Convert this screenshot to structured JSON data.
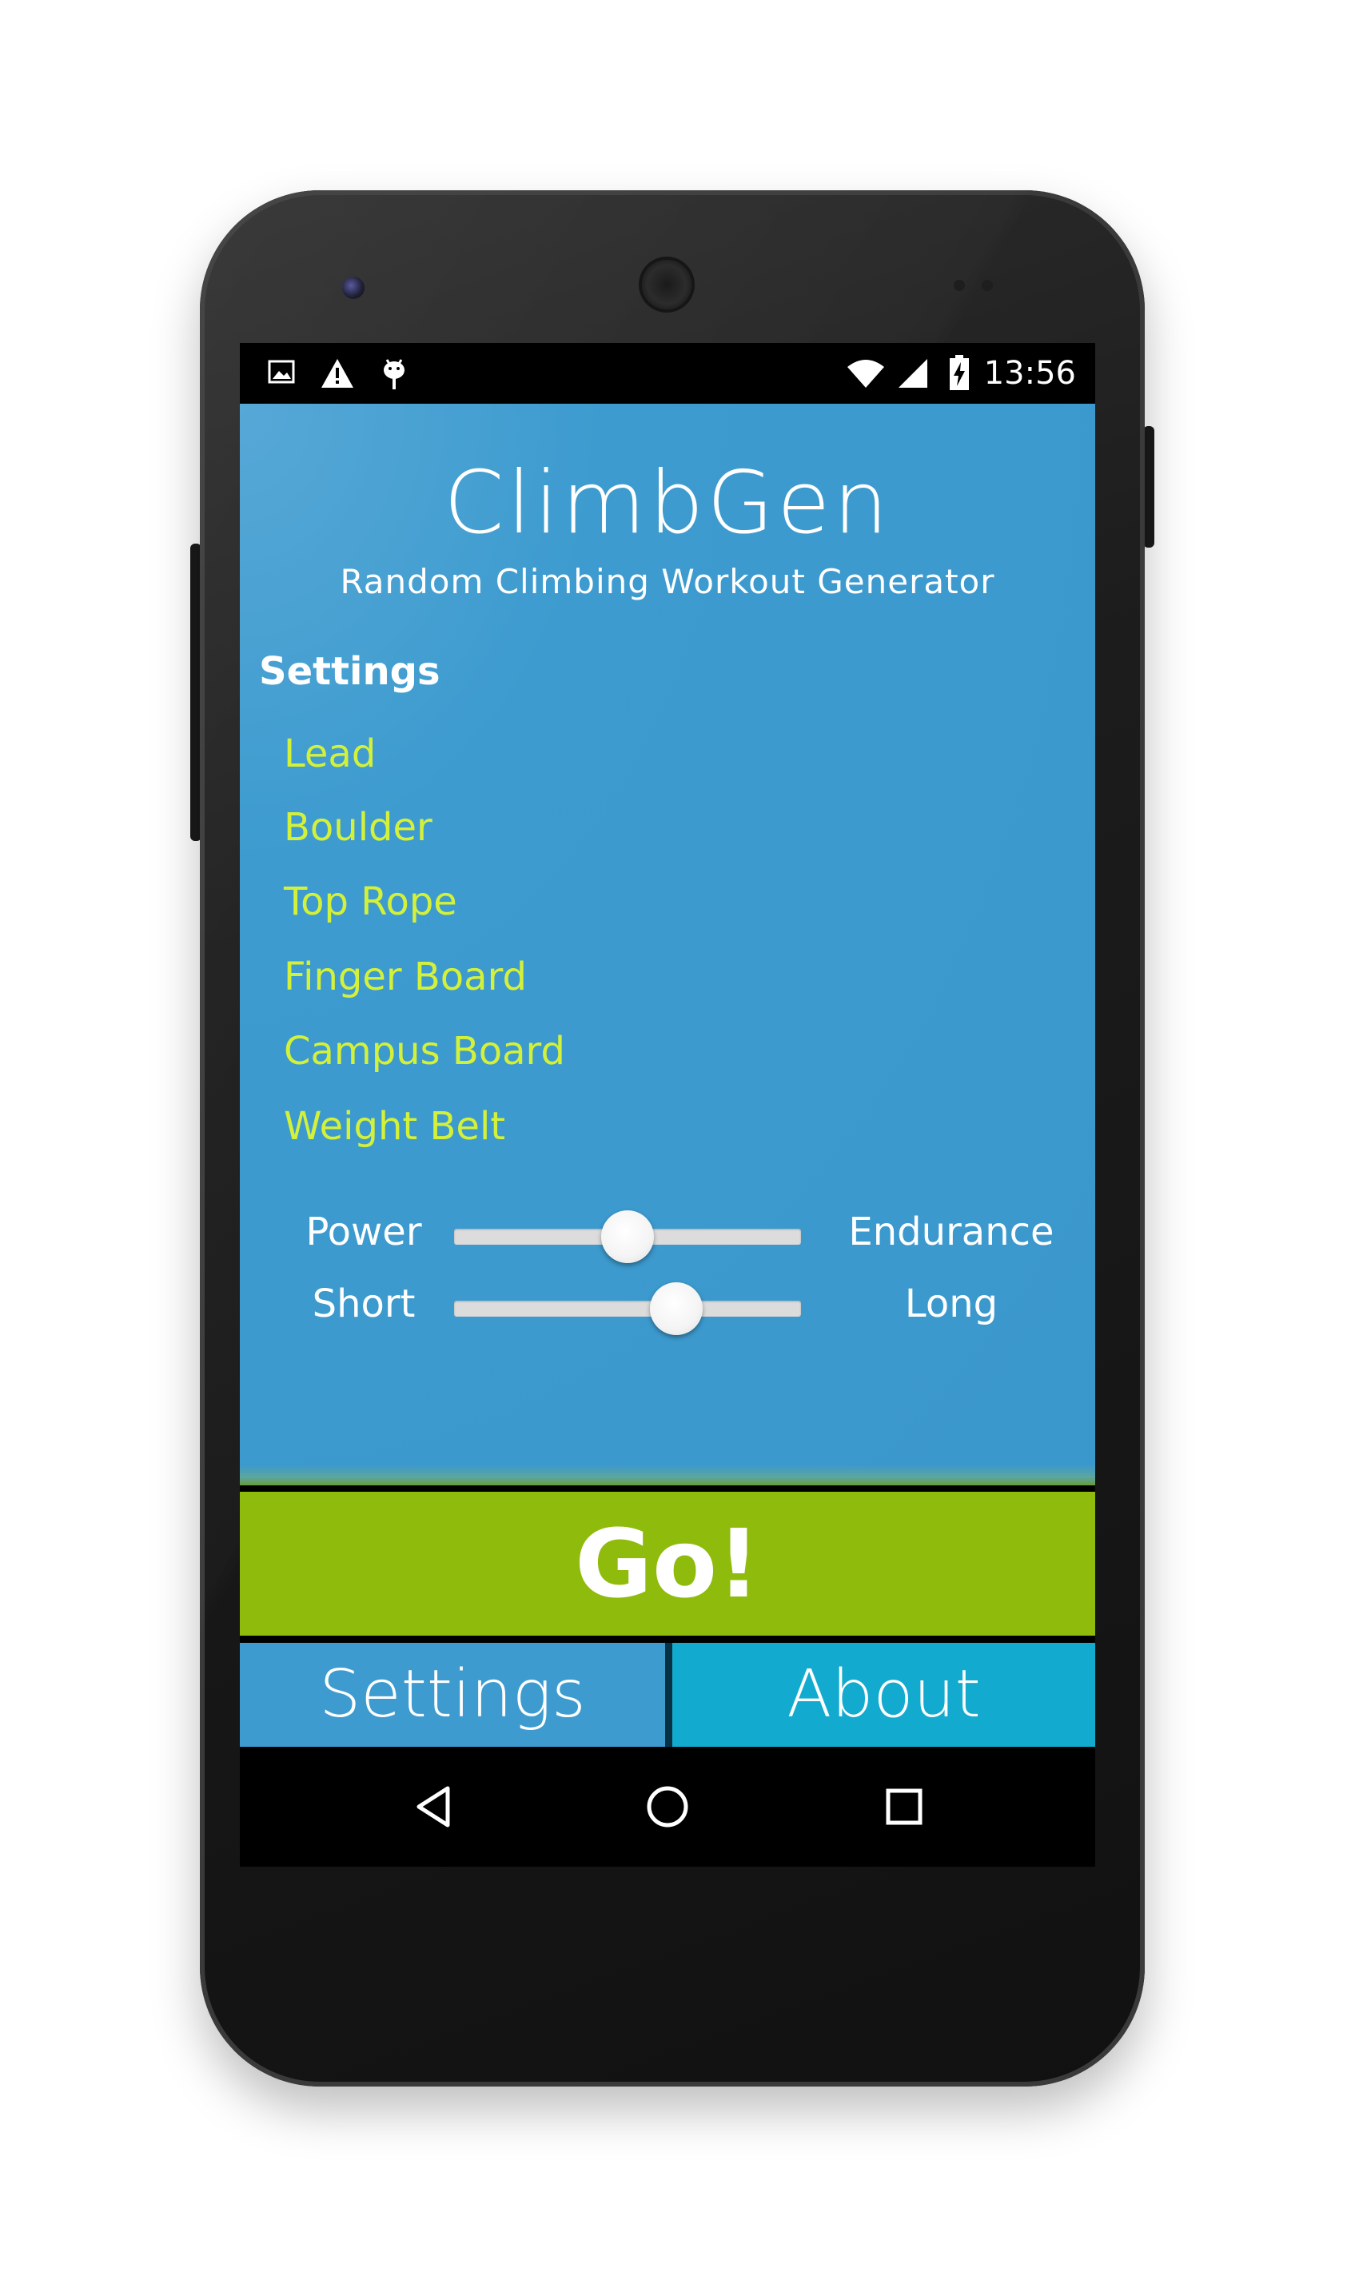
{
  "statusbar": {
    "time": "13:56",
    "left_icons": [
      "image-icon",
      "warning-icon",
      "android-debug-icon"
    ],
    "right_icons": [
      "wifi-icon",
      "signal-icon",
      "battery-charging-icon"
    ]
  },
  "app": {
    "title": "ClimbGen",
    "subtitle": "Random Climbing Workout Generator",
    "settings_heading": "Settings",
    "options": [
      {
        "label": "Lead"
      },
      {
        "label": "Boulder"
      },
      {
        "label": "Top Rope"
      },
      {
        "label": "Finger Board"
      },
      {
        "label": "Campus Board"
      },
      {
        "label": "Weight Belt"
      }
    ],
    "sliders": [
      {
        "left_label": "Power",
        "right_label": "Endurance",
        "value": 0.5
      },
      {
        "left_label": "Short",
        "right_label": "Long",
        "value": 0.64
      }
    ],
    "go_label": "Go!",
    "tabs": [
      {
        "label": "Settings"
      },
      {
        "label": "About"
      }
    ]
  },
  "navbar": {
    "icons": [
      "back-icon",
      "home-icon",
      "recents-icon"
    ]
  },
  "colors": {
    "background_blue": "#3b98cc",
    "option_text": "#d4f13a",
    "go_green": "#8fbc0c",
    "about_tab": "#13aacf"
  }
}
